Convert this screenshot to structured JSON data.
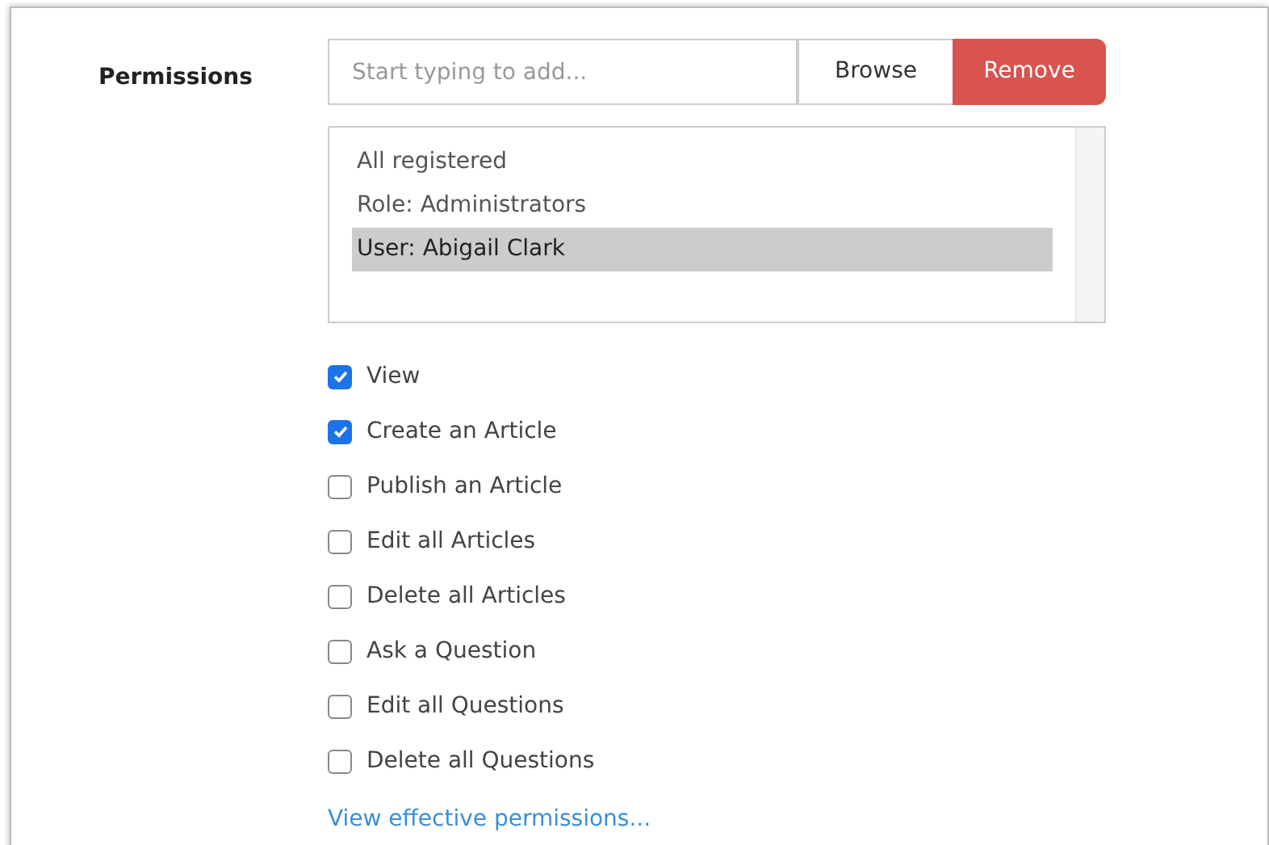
{
  "permissions": {
    "label": "Permissions",
    "search": {
      "placeholder": "Start typing to add..."
    },
    "buttons": [
      {
        "label": "Browse",
        "kind": "default"
      },
      {
        "label": "Remove",
        "kind": "danger"
      }
    ],
    "principals": [
      {
        "label": "All registered",
        "selected": false
      },
      {
        "label": "Role: Administrators",
        "selected": false
      },
      {
        "label": "User: Abigail Clark",
        "selected": true
      }
    ],
    "rights": [
      {
        "label": "View",
        "checked": true
      },
      {
        "label": "Create an Article",
        "checked": true
      },
      {
        "label": "Publish an Article",
        "checked": false
      },
      {
        "label": "Edit all Articles",
        "checked": false
      },
      {
        "label": "Delete all Articles",
        "checked": false
      },
      {
        "label": "Ask a Question",
        "checked": false
      },
      {
        "label": "Edit all Questions",
        "checked": false
      },
      {
        "label": "Delete all Questions",
        "checked": false
      }
    ],
    "link": "View effective permissions..."
  }
}
